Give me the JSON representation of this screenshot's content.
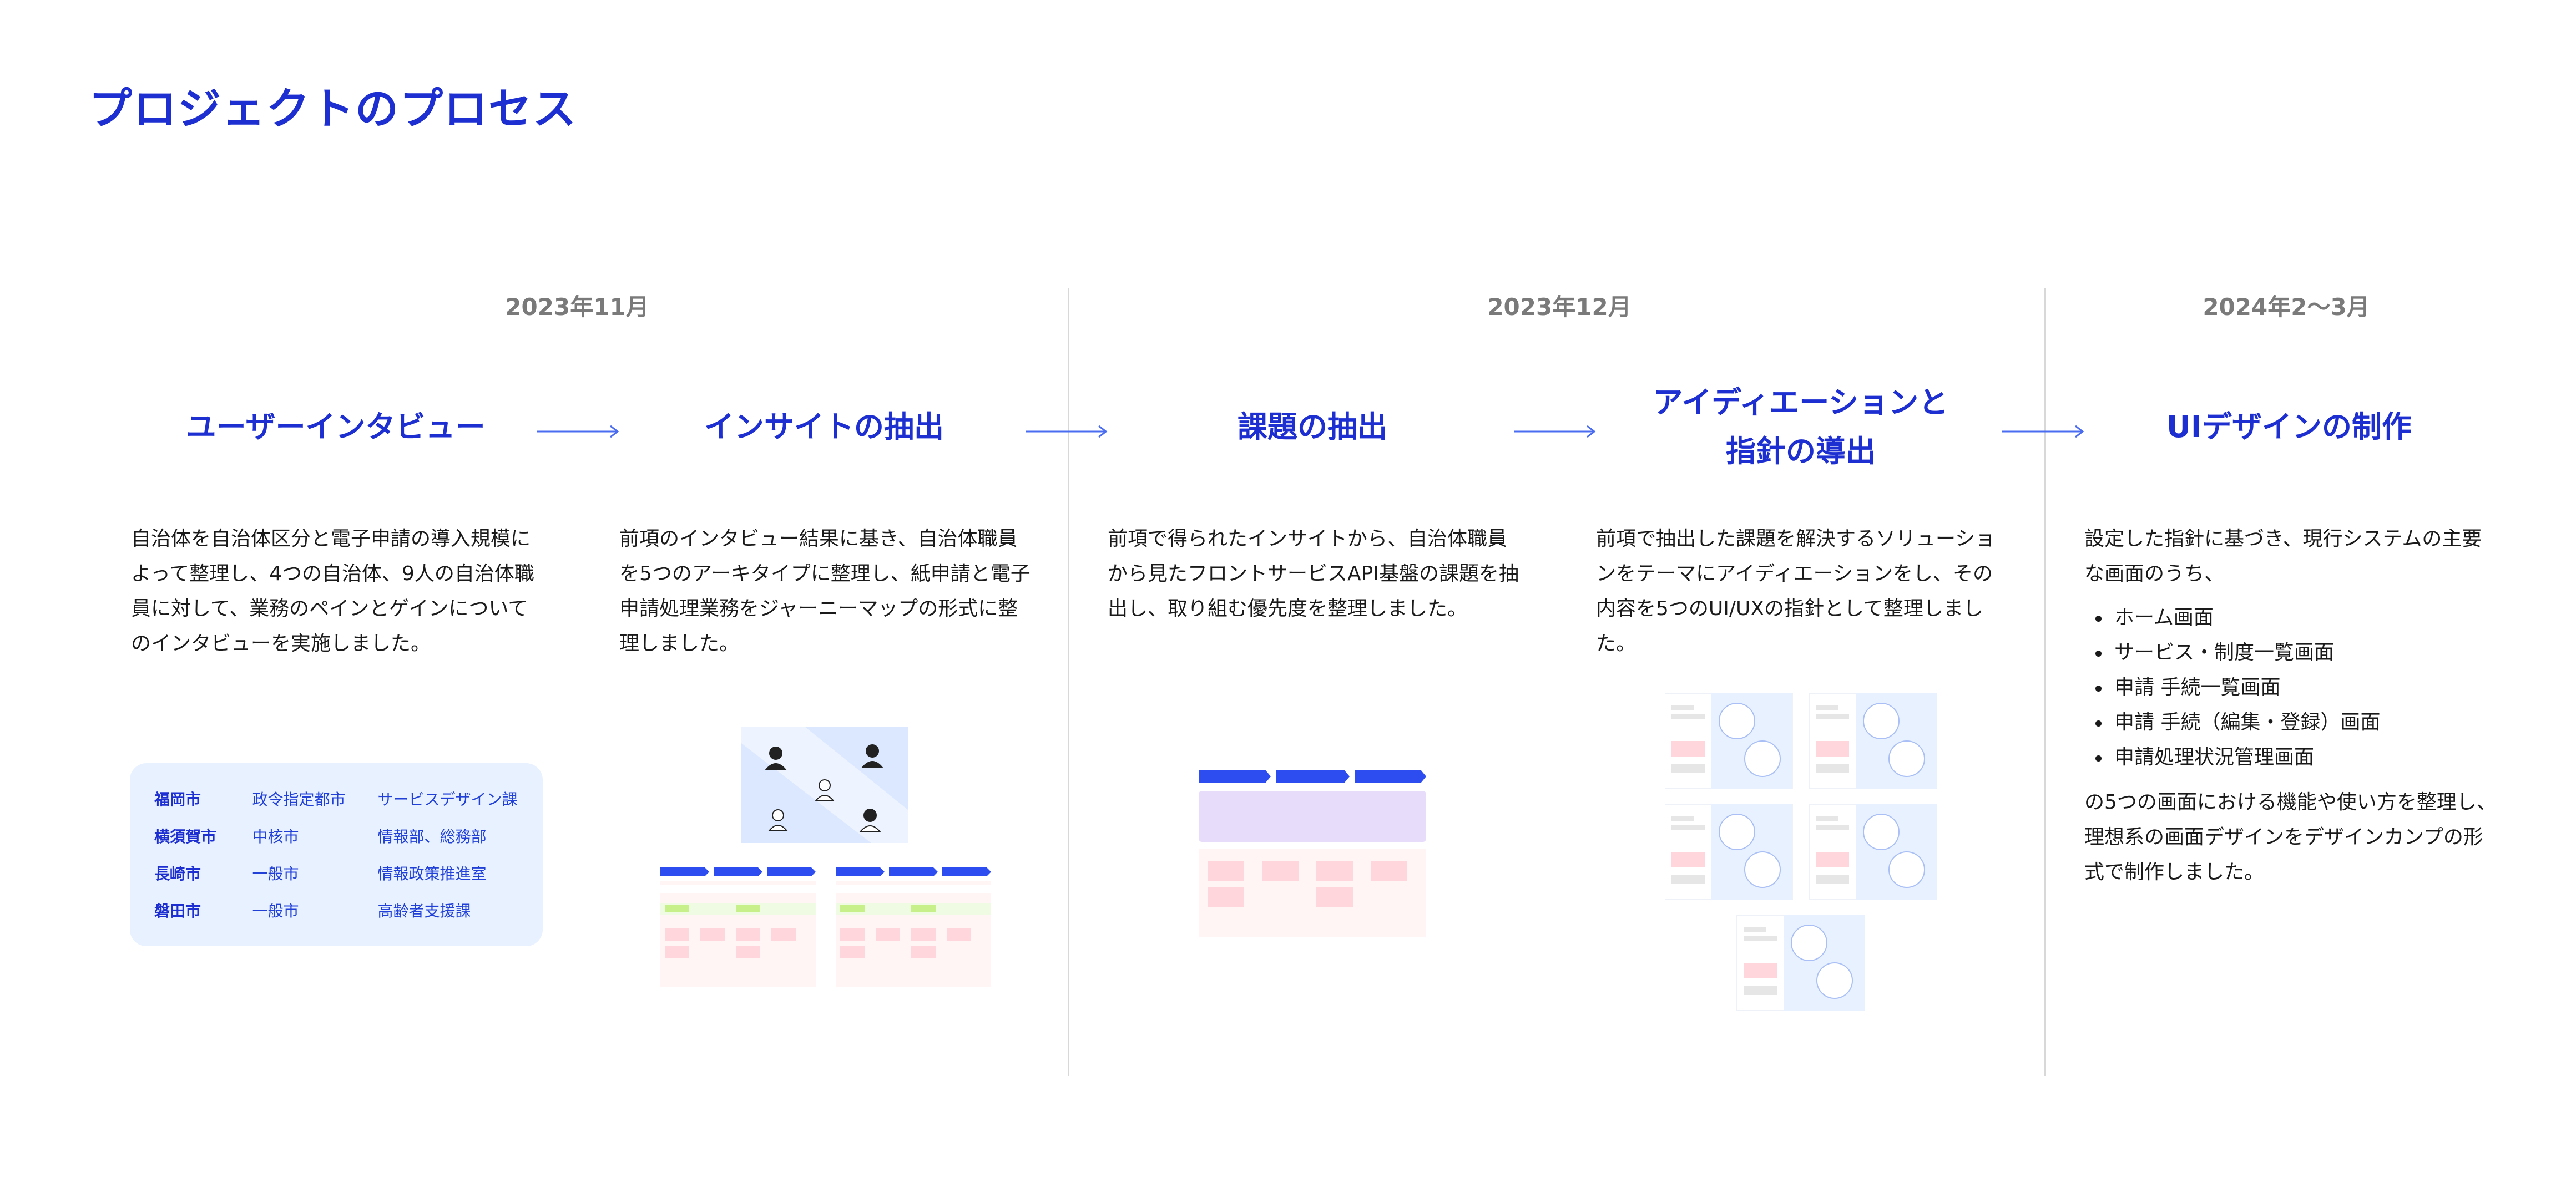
{
  "title": "プロジェクトのプロセス",
  "periods": [
    {
      "label": "2023年11月"
    },
    {
      "label": "2023年12月"
    },
    {
      "label": "2024年2〜3月"
    }
  ],
  "steps": [
    {
      "title_lines": [
        "ユーザーインタビュー"
      ],
      "description": "自治体を自治体区分と電子申請の導入規模によって整理し、4つの自治体、9人の自治体職員に対して、業務のペインとゲインについてのインタビューを実施しました。"
    },
    {
      "title_lines": [
        "インサイトの抽出"
      ],
      "description": "前項のインタビュー結果に基き、自治体職員を5つのアーキタイプに整理し、紙申請と電子申請処理業務をジャーニーマップの形式に整理しました。"
    },
    {
      "title_lines": [
        "課題の抽出"
      ],
      "description": "前項で得られたインサイトから、自治体職員から見たフロントサービスAPI基盤の課題を抽出し、取り組む優先度を整理しました。"
    },
    {
      "title_lines": [
        "アイディエーションと",
        "指針の導出"
      ],
      "description": "前項で抽出した課題を解決するソリューションをテーマにアイディエーションをし、その内容を5つのUI/UXの指針として整理しました。"
    },
    {
      "title_lines": [
        "UIデザインの制作"
      ],
      "description_intro": "設定した指針に基づき、現行システムの主要な画面のうち、",
      "bullets": [
        "ホーム画面",
        "サービス・制度一覧画面",
        "申請 手続一覧画面",
        "申請 手続（編集・登録）画面",
        "申請処理状況管理画面"
      ],
      "description_outro": "の5つの画面における機能や使い方を整理し、理想系の画面デザインをデザインカンプの形式で制作しました。"
    }
  ],
  "cities": [
    {
      "name": "福岡市",
      "type": "政令指定都市",
      "dept": "サービスデザイン課"
    },
    {
      "name": "横須賀市",
      "type": "中核市",
      "dept": "情報部、総務部"
    },
    {
      "name": "長崎市",
      "type": "一般市",
      "dept": "情報政策推進室"
    },
    {
      "name": "磐田市",
      "type": "一般市",
      "dept": "高齢者支援課"
    }
  ],
  "colors": {
    "accent": "#1d2fd0",
    "arrow": "#4a6cf0",
    "card_bg": "#e8f1ff",
    "period_text": "#7a7a7a",
    "divider": "#d8d8d8",
    "sticky_pink": "#ffd6dc",
    "sticky_green": "#c7f08a",
    "lane_purple": "#e8dcfb"
  }
}
